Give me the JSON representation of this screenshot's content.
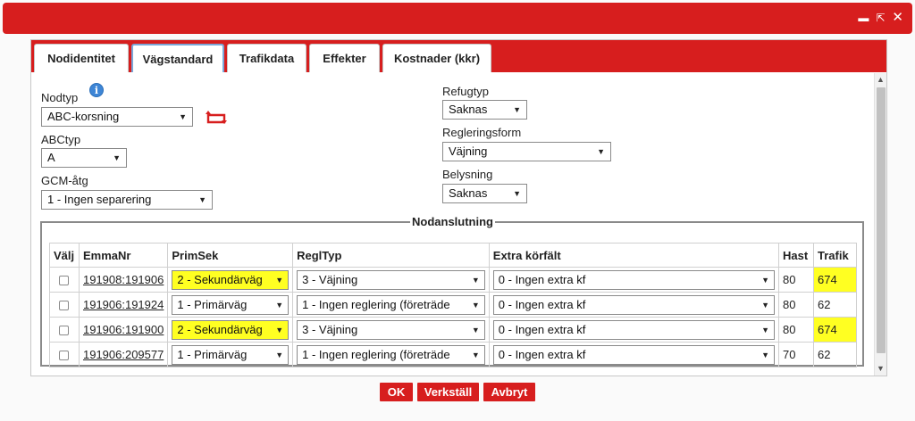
{
  "titlebar": {
    "minimize_icon": "minimize-icon",
    "maximize_icon": "maximize-icon",
    "close_icon": "close-icon"
  },
  "tabs": [
    {
      "label": "Nodidentitet"
    },
    {
      "label": "Vägstandard",
      "active": true
    },
    {
      "label": "Trafikdata"
    },
    {
      "label": "Effekter"
    },
    {
      "label": "Kostnader (kkr)"
    }
  ],
  "form": {
    "nodtyp_label": "Nodtyp",
    "nodtyp_value": "ABC-korsning",
    "abctyp_label": "ABCtyp",
    "abctyp_value": "A",
    "gcm_label": "GCM-åtg",
    "gcm_value": "1 - Ingen separering",
    "refugtyp_label": "Refugtyp",
    "refugtyp_value": "Saknas",
    "reglering_label": "Regleringsform",
    "reglering_value": "Väjning",
    "belysning_label": "Belysning",
    "belysning_value": "Saknas"
  },
  "nodanslutning": {
    "legend": "Nodanslutning",
    "columns": [
      "Välj",
      "EmmaNr",
      "PrimSek",
      "ReglTyp",
      "Extra körfält",
      "Hast",
      "Trafik"
    ],
    "rows": [
      {
        "emmanr": "191908:191906",
        "primsek": "2 - Sekundärväg",
        "regltyp": "3 - Väjning",
        "extra": "0 - Ingen extra kf",
        "hast": "80",
        "trafik": "674",
        "highlight": true
      },
      {
        "emmanr": "191906:191924",
        "primsek": "1 - Primärväg",
        "regltyp": "1 - Ingen reglering (företräde",
        "extra": "0 - Ingen extra kf",
        "hast": "80",
        "trafik": "62",
        "highlight": false
      },
      {
        "emmanr": "191906:191900",
        "primsek": "2 - Sekundärväg",
        "regltyp": "3 - Väjning",
        "extra": "0 - Ingen extra kf",
        "hast": "80",
        "trafik": "674",
        "highlight": true
      },
      {
        "emmanr": "191906:209577",
        "primsek": "1 - Primärväg",
        "regltyp": "1 - Ingen reglering (företräde",
        "extra": "0 - Ingen extra kf",
        "hast": "70",
        "trafik": "62",
        "highlight": false
      }
    ]
  },
  "footer": {
    "ok_label": "OK",
    "apply_label": "Verkställ",
    "cancel_label": "Avbryt"
  },
  "colors": {
    "brand_red": "#d71e1e",
    "highlight_yellow": "#ffff22",
    "info_blue": "#3e86d6"
  }
}
